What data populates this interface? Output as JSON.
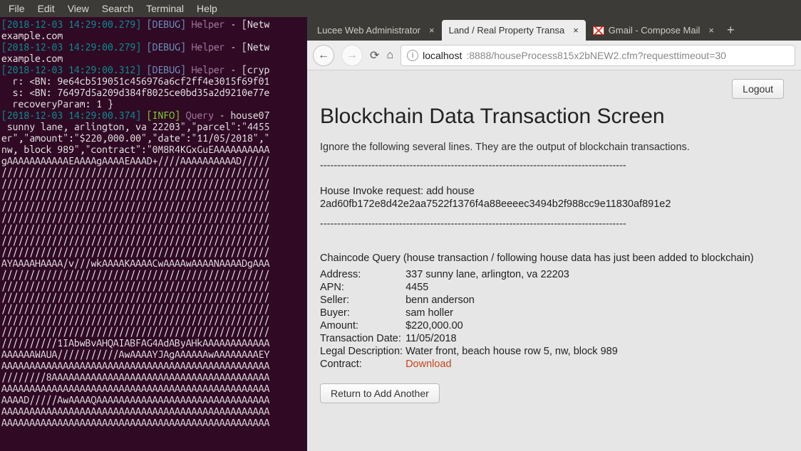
{
  "menubar": [
    "File",
    "Edit",
    "View",
    "Search",
    "Terminal",
    "Help"
  ],
  "terminal": {
    "l1_ts": "[2018-12-03 14:29:00.279]",
    "l1_lvl": "[DEBUG]",
    "l1_src": "Helper",
    "l1_txt": " - [Netw",
    "l2": "example.com",
    "l3_ts": "[2018-12-03 14:29:00.279]",
    "l3_lvl": "[DEBUG]",
    "l3_src": "Helper",
    "l3_txt": " - [Netw",
    "l4": "example.com",
    "l5_ts": "[2018-12-03 14:29:00.312]",
    "l5_lvl": "[DEBUG]",
    "l5_src": "Helper",
    "l5_txt": " - [cryp",
    "l6": "  r: <BN: 9e64cb519051c456976a6cf2ff4e3015f69f01",
    "l7": "  s: <BN: 76497d5a209d384f8025ce0bd35a2d9210e77e",
    "l8": "  recoveryParam: 1 }",
    "l9_ts": "[2018-12-03 14:29:00.374]",
    "l9_lvl": "[INFO]",
    "l9_src": "Query",
    "l9_txt": " - house07",
    "l10": " sunny lane, arlington, va 22203\",\"parcel\":\"4455",
    "l11": "er\",\"amount\":\"$220,000.00\",\"date\":\"11/05/2018\",\"",
    "l12": "nw, block 989\",\"contract\":\"0M8R4KGxGuEAAAAAAAAAA",
    "l13": "gAAAAAAAAAAAEAAAAgAAAAEAAAD+////AAAAAAAAAAD/////",
    "lfill": "////////////////////////////////////////////////",
    "l15": "AYAAAAHAAAA/v///wkAAAAKAAAACwAAAAwAAAANAAAADgAAA",
    "l16": "//////////1IAbwBvAHQAIABFAG4AdAByAHkAAAAAAAAAAAA",
    "l17": "AAAAAAWAUA///////////AwAAAAYJAgAAAAAAwAAAAAAAAEY",
    "l18": "AAAAAAAAAAAAAAAAAAAAAAAAAAAAAAAAAAAAAAAAAAAAAAAA",
    "l19": "////////8AAAAAAAAAAAAAAAAAAAAAAAAAAAAAAAAAAAAAAA",
    "l20": "AAAAAAAAAAAAAAAAAAAAAAAAAAAAAAAAAAAAAAAAAAAAAAAA",
    "l21": "AAAAD/////AwAAAAQAAAAAAAAAAAAAAAAAAAAAAAAAAAAAAA"
  },
  "tabs": {
    "t1": "Lucee Web Administrator",
    "t2": "Land / Real Property Transa",
    "t3": "Gmail - Compose Mail"
  },
  "url": {
    "host": "localhost",
    "rest": ":8888/houseProcess815x2bNEW2.cfm?requesttimeout=30"
  },
  "page": {
    "logout": "Logout",
    "title": "Blockchain Data Transaction Screen",
    "note": "Ignore the following several lines. They are the output of blockchain transactions.",
    "sep": "-----------------------------------------------------------------------------------------",
    "req_label": "House Invoke request: add house",
    "hash": "2ad60fb172e8d42e2aa7522f1376f4a88eeeec3494b2f988cc9e11830af891e2",
    "query_h": "Chaincode Query (house transaction / following house data has just been added to blockchain)",
    "rows": [
      {
        "k": "Address:",
        "v": "337 sunny lane, arlington, va 22203"
      },
      {
        "k": "APN:",
        "v": "4455"
      },
      {
        "k": "Seller:",
        "v": "benn anderson"
      },
      {
        "k": "Buyer:",
        "v": "sam holler"
      },
      {
        "k": "Amount:",
        "v": "$220,000.00"
      },
      {
        "k": "Transaction Date:",
        "v": "11/05/2018"
      },
      {
        "k": "Legal Description:",
        "v": "Water front, beach house row 5, nw, block 989"
      }
    ],
    "contract_k": "Contract:",
    "contract_v": "Download",
    "return": "Return to Add Another"
  }
}
